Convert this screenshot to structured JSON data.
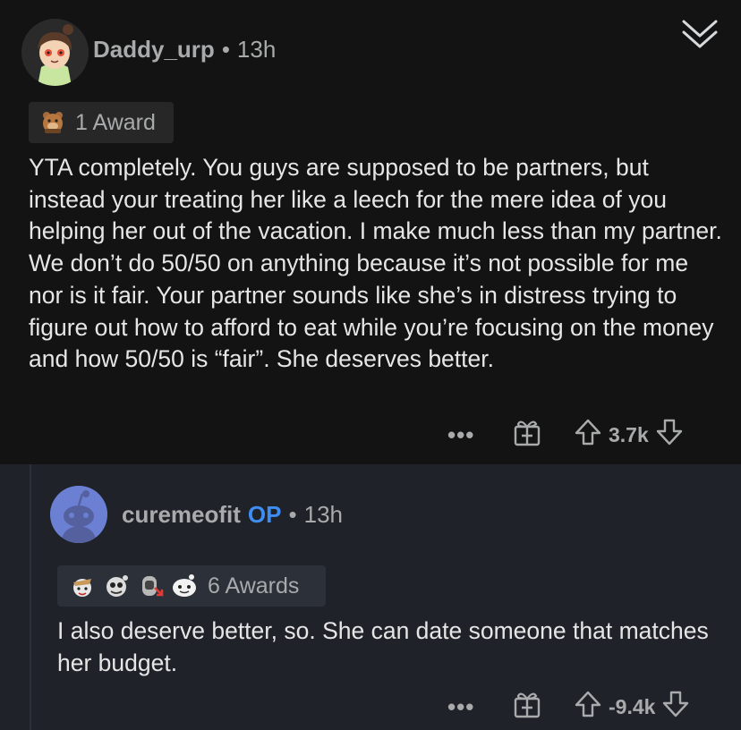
{
  "comment1": {
    "username": "Daddy_urp",
    "separator": "•",
    "time": "13h",
    "awards_label": "1 Award",
    "body": "YTA completely. You guys are supposed to be partners, but instead your treating her like a leech for the mere idea of you helping her out of the vacation. I make much less than my partner. We don’t do 50/50 on anything because it’s not possible for me nor is it fair. Your partner sounds like she’s in distress trying to figure out how to afford to eat while you’re focusing on the money and how 50/50 is “fair”. She deserves better.",
    "more": "•••",
    "score": "3.7k",
    "icons": [
      "avatar-girl",
      "bear-award-icon",
      "gift-icon",
      "upvote-icon",
      "downvote-icon",
      "collapse-chevron-icon"
    ]
  },
  "comment2": {
    "username": "curemeofit",
    "op_badge": "OP",
    "separator": "•",
    "time": "13h",
    "awards_label": "6 Awards",
    "body": "I also deserve better, so. She can date someone that matches her budget.",
    "more": "•••",
    "score": "-9.4k",
    "icons": [
      "avatar-snoo",
      "award-icon",
      "gift-icon",
      "upvote-icon",
      "downvote-icon"
    ]
  },
  "colors": {
    "background_top": "#131313",
    "background_reply": "#1f2229",
    "meta_text": "#a8aaab",
    "body_text": "#e6e6e6",
    "op_blue": "#3d8df2"
  }
}
